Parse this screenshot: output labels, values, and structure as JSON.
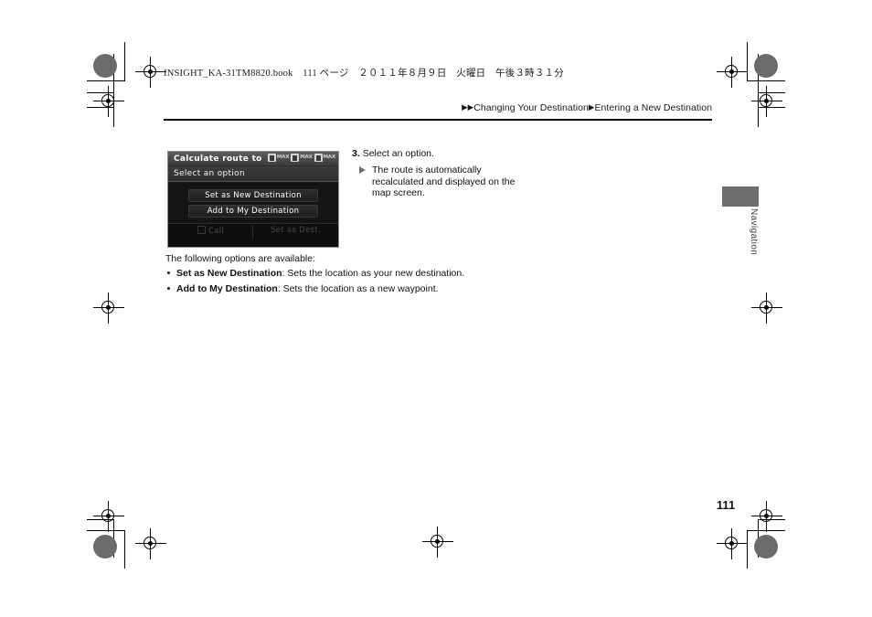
{
  "page": {
    "book_header": "INSIGHT_KA-31TM8820.book　111 ページ　２０１１年８月９日　火曜日　午後３時３１分",
    "page_number": "111"
  },
  "breadcrumb": {
    "marker_double": "▶▶",
    "section": "Changing Your Destination",
    "marker_single": "▶",
    "subsection": "Entering a New Destination"
  },
  "side_tab": {
    "label": "Navigation",
    "color": "#6e6e6e"
  },
  "nav_screen": {
    "title": "Calculate route to",
    "subtitle": "Select an option",
    "status_indicators": [
      {
        "icon": "signal-max-icon",
        "label": "MAX"
      },
      {
        "icon": "signal-max-icon",
        "label": "MAX"
      },
      {
        "icon": "signal-max-icon",
        "label": "MAX"
      }
    ],
    "buttons": [
      {
        "label": "Set as New Destination"
      },
      {
        "label": "Add to My Destination"
      }
    ],
    "footer": {
      "call_label": "Call",
      "set_dest_label": "Set as Dest."
    }
  },
  "step": {
    "number": "3.",
    "text": "Select an option.",
    "note": "The route is automatically recalculated and displayed on the map screen."
  },
  "options_section": {
    "intro": "The following options are available:",
    "items": [
      {
        "term": "Set as New Destination",
        "description": ": Sets the location as your new destination."
      },
      {
        "term": "Add to My Destination",
        "description": ": Sets the location as a new waypoint."
      }
    ]
  }
}
